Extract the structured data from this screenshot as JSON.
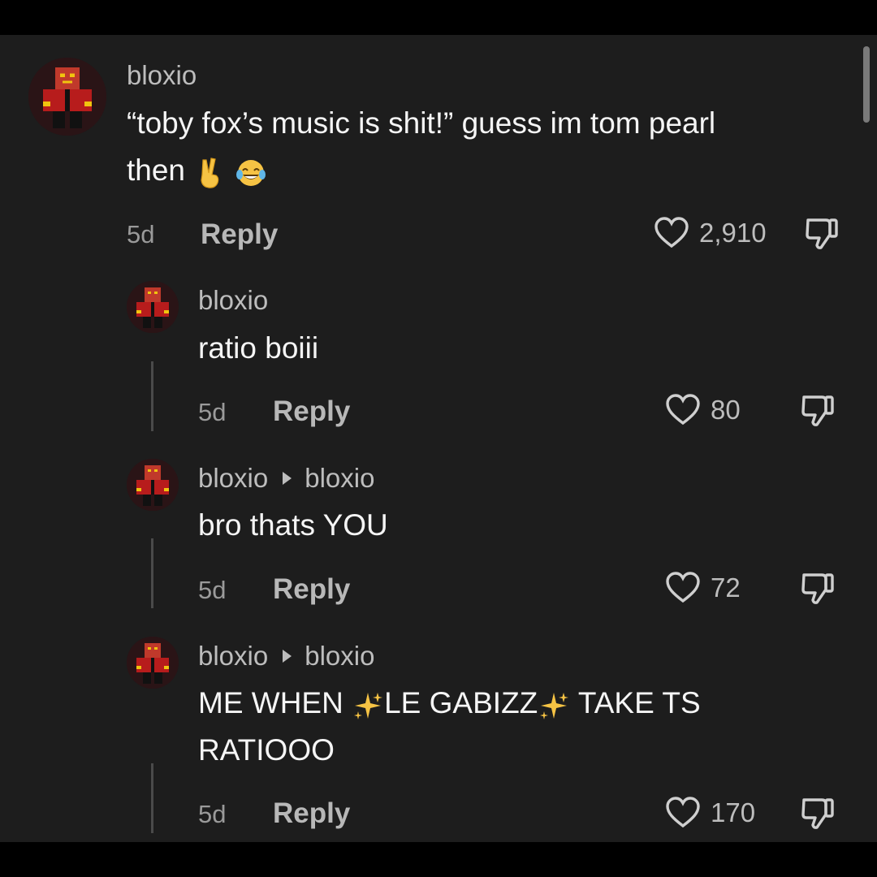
{
  "comments": [
    {
      "username": "bloxio",
      "reply_to": "",
      "text_line1": "“toby fox’s music is shit!” guess im tom pearl",
      "text_line2": "then",
      "time": "5d",
      "reply_label": "Reply",
      "likes": "2,910",
      "emoji": [
        "victory-hand-emoji",
        "tears-of-joy-emoji"
      ]
    },
    {
      "username": "bloxio",
      "reply_to": "",
      "text_line1": "ratio boiii",
      "time": "5d",
      "reply_label": "Reply",
      "likes": "80"
    },
    {
      "username": "bloxio",
      "reply_to": "bloxio",
      "text_line1": "bro thats YOU",
      "time": "5d",
      "reply_label": "Reply",
      "likes": "72"
    },
    {
      "username": "bloxio",
      "reply_to": "bloxio",
      "text_a": "ME WHEN ",
      "text_b": "LE GABIZZ",
      "text_c": " TAKE TS",
      "text_line2": "RATIOOO",
      "time": "5d",
      "reply_label": "Reply",
      "likes": "170",
      "emoji": [
        "sparkles-emoji",
        "sparkles-emoji"
      ]
    }
  ],
  "colors": {
    "panel_bg": "#1d1d1d",
    "frame_bg": "#000000",
    "text_primary": "#f5f5f5",
    "text_secondary": "#bdbdbd"
  }
}
